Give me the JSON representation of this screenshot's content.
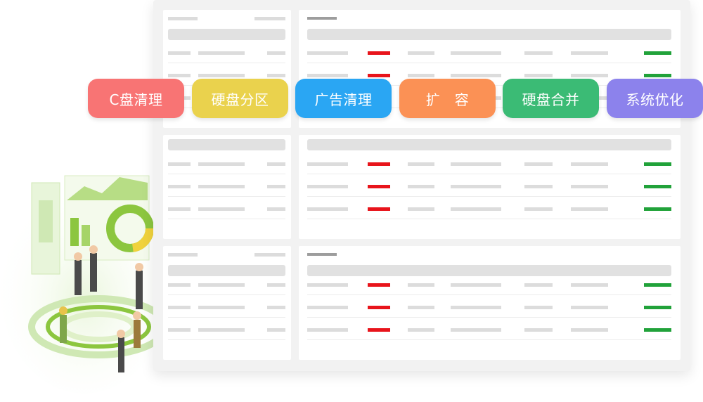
{
  "toolbar": {
    "buttons": [
      {
        "label": "C盘清理",
        "color": "#f87474"
      },
      {
        "label": "硬盘分区",
        "color": "#ead24d"
      },
      {
        "label": "广告清理",
        "color": "#2aa6f3"
      },
      {
        "label": "扩　容",
        "color": "#fb9155"
      },
      {
        "label": "硬盘合并",
        "color": "#3bbb75"
      },
      {
        "label": "系统优化",
        "color": "#8c82ec"
      }
    ]
  },
  "colors": {
    "panel_bg": "#f2f2f2",
    "placeholder": "#dcdcdc",
    "status_red": "#e8141b",
    "status_green": "#21a23a",
    "illustration_green": "#8cc63f"
  },
  "icons": [
    "team-dashboard-illustration"
  ]
}
